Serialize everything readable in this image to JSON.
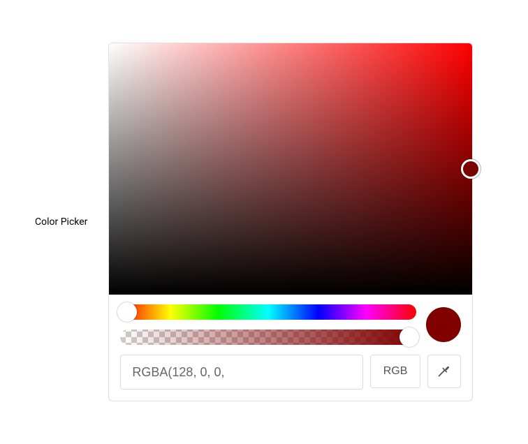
{
  "label": "Color Picker",
  "color": {
    "hex": "#800000",
    "input_value": "RGBA(128, 0, 0,",
    "mode_label": "RGB"
  },
  "sliders": {
    "hue": 0,
    "alpha": 1
  }
}
